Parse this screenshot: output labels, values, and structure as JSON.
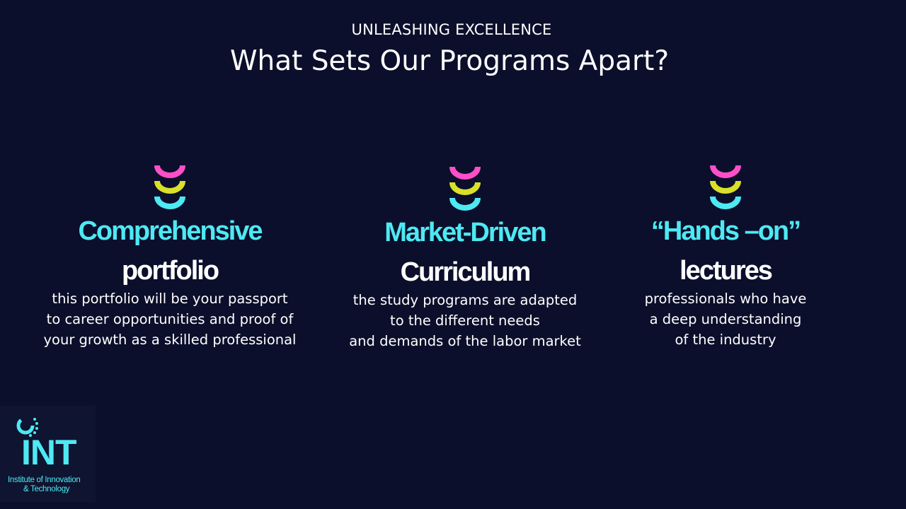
{
  "header": {
    "eyebrow": "UNLEASHING EXCELLENCE",
    "headline": "What Sets Our Programs Apart?"
  },
  "features": [
    {
      "keyword": "Comprehensive",
      "subtitle": "portfolio",
      "description": "this portfolio will be your passport\nto career opportunities and proof of\nyour growth as a skilled professional"
    },
    {
      "keyword": "Market-Driven",
      "subtitle": "Curriculum",
      "description": "the study programs are adapted\nto the different needs\nand demands of the labor market"
    },
    {
      "keyword": "“Hands –on”",
      "subtitle": "lectures",
      "description": "professionals who have\na deep understanding\nof the industry"
    }
  ],
  "logo": {
    "acronym": "INT",
    "name_line1": "Institute of Innovation",
    "name_line2": "& Technology"
  },
  "colors": {
    "background": "#0b0f2b",
    "accent_cyan": "#4ee9f3",
    "accent_pink": "#ff4fc8",
    "accent_yellow": "#d9e02a"
  }
}
